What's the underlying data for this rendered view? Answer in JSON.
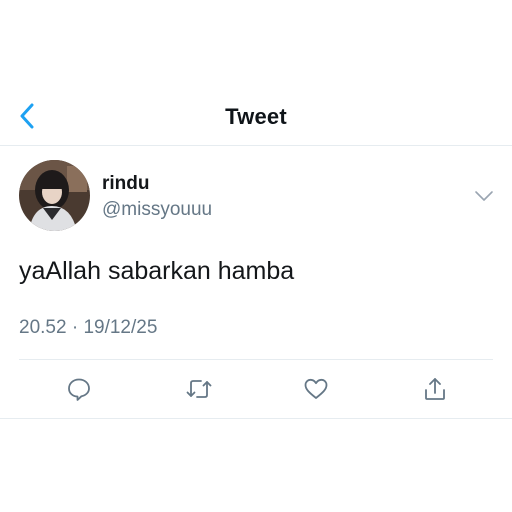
{
  "header": {
    "title": "Tweet",
    "back_icon": "chevron-left-icon",
    "accent_color": "#1da1f2"
  },
  "tweet": {
    "display_name": "rindu",
    "handle": "@missyouuu",
    "text": "yaAllah sabarkan hamba",
    "time": "20.52",
    "separator": "·",
    "date": "19/12/25"
  },
  "actions": [
    {
      "icon": "reply-icon"
    },
    {
      "icon": "retweet-icon"
    },
    {
      "icon": "like-icon"
    },
    {
      "icon": "share-icon"
    }
  ],
  "colors": {
    "text": "#14171a",
    "secondary": "#657786",
    "divider": "#e6ecf0",
    "icon": "#657786"
  }
}
